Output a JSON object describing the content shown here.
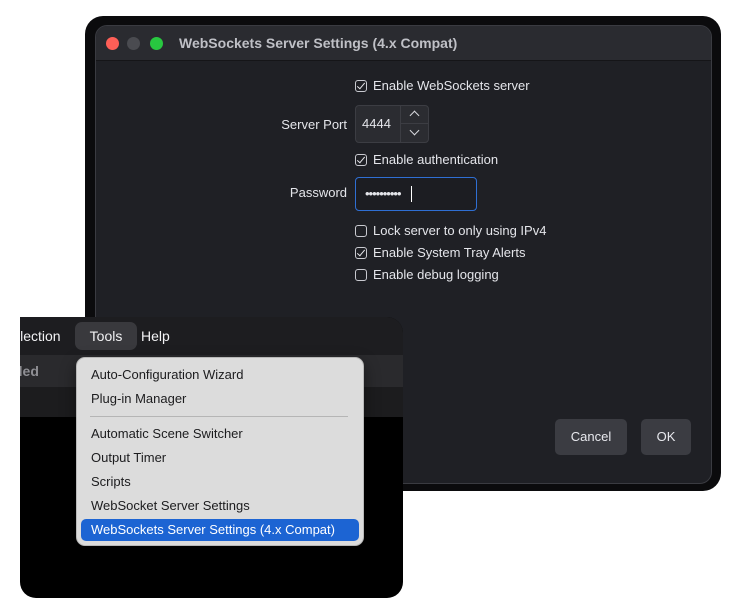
{
  "settings_window": {
    "title": "WebSockets Server Settings (4.x Compat)",
    "enable_server": {
      "label": "Enable WebSockets server",
      "checked": true
    },
    "server_port": {
      "label": "Server Port",
      "value": "4444"
    },
    "enable_auth": {
      "label": "Enable authentication",
      "checked": true
    },
    "password": {
      "label": "Password",
      "value": "••••••••••"
    },
    "lock_ipv4": {
      "label": "Lock server to only using IPv4",
      "checked": false
    },
    "tray_alerts": {
      "label": "Enable System Tray Alerts",
      "checked": true
    },
    "debug_logging": {
      "label": "Enable debug logging",
      "checked": false
    },
    "cancel_label": "Cancel",
    "ok_label": "OK"
  },
  "menubar": {
    "items": [
      "Scene Collection",
      "Tools",
      "Help"
    ],
    "collection_visible": "llection",
    "tools": "Tools",
    "help": "Help",
    "untitled_visible": "tled"
  },
  "tools_menu": {
    "items": [
      "Auto-Configuration Wizard",
      "Plug-in Manager",
      "Automatic Scene Switcher",
      "Output Timer",
      "Scripts",
      "WebSocket Server Settings",
      "WebSockets Server Settings (4.x Compat)"
    ],
    "selected_index": 6
  },
  "colors": {
    "accent": "#1c64d3",
    "focus_border": "#2f6fd3",
    "close": "#fe5f57",
    "zoom": "#28c840"
  }
}
